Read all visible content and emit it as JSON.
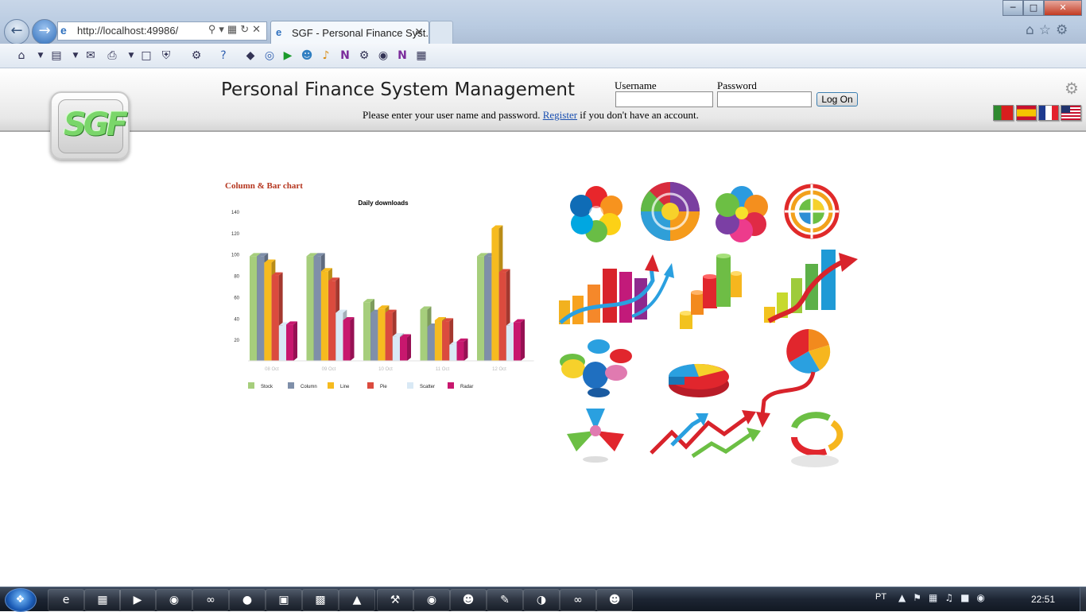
{
  "browser": {
    "url": "http://localhost:49986/",
    "tab_title": "SGF - Personal Finance Syst...",
    "back_icon": "back-arrow-icon",
    "forward_icon": "forward-arrow-icon",
    "close_glyph": "✕"
  },
  "header": {
    "logo_text": "SGF",
    "title": "Personal Finance System Management",
    "username_label": "Username",
    "password_label": "Password",
    "username_value": "",
    "password_value": "",
    "logon_label": "Log On",
    "message_before": "Please enter your user name and password. ",
    "register_link": "Register",
    "message_after": " if you don't have an account.",
    "flags": [
      "Portugal",
      "Spain",
      "France",
      "United States"
    ]
  },
  "chart_section": {
    "heading": "Column & Bar chart"
  },
  "chart_data": {
    "type": "bar",
    "title": "Daily downloads",
    "categories": [
      "08 Oct",
      "09 Oct",
      "10 Oct",
      "11 Oct",
      "12 Oct"
    ],
    "series": [
      {
        "name": "Stock",
        "color": "#a6ce7c",
        "values": [
          98,
          98,
          55,
          48,
          98
        ]
      },
      {
        "name": "Column",
        "color": "#7f8fa9",
        "values": [
          98,
          98,
          45,
          32,
          98
        ]
      },
      {
        "name": "Line",
        "color": "#f6bb1f",
        "values": [
          92,
          84,
          49,
          38,
          124
        ]
      },
      {
        "name": "Pie",
        "color": "#db4b3e",
        "values": [
          80,
          75,
          45,
          37,
          83
        ]
      },
      {
        "name": "Scatter",
        "color": "#d9e9f5",
        "values": [
          33,
          45,
          23,
          15,
          33
        ]
      },
      {
        "name": "Radar",
        "color": "#c8176e",
        "values": [
          34,
          38,
          22,
          18,
          36
        ]
      }
    ],
    "yticks": [
      20,
      40,
      60,
      80,
      100,
      120,
      140
    ],
    "ylim": [
      0,
      140
    ],
    "legend_position": "bottom",
    "grid": false
  },
  "clipart": {
    "items": [
      "flower-pie-icon",
      "color-wheel-icon",
      "flower-pie-icon-2",
      "target-pie-icon",
      "bar-chart-arrow-icon",
      "cylinder-chart-icon",
      "rising-bars-arrow-icon",
      "cylinder-pie-icon",
      "pie-3d-icon",
      "pie-arrow-icon",
      "radiation-pie-icon",
      "zigzag-arrows-icon",
      "cycle-arrows-icon"
    ]
  },
  "taskbar": {
    "apps": [
      "ie-icon",
      "explorer-icon",
      "media-player-icon",
      "firefox-icon",
      "vs-icon",
      "disc-icon",
      "app-icon-7",
      "app-icon-8",
      "app-icon-9",
      "tools-icon",
      "chrome-icon",
      "people-icon",
      "notepad-icon",
      "globe-icon",
      "vs-debug-icon",
      "paint-icon"
    ],
    "lang": "PT",
    "clock": "22:51"
  }
}
